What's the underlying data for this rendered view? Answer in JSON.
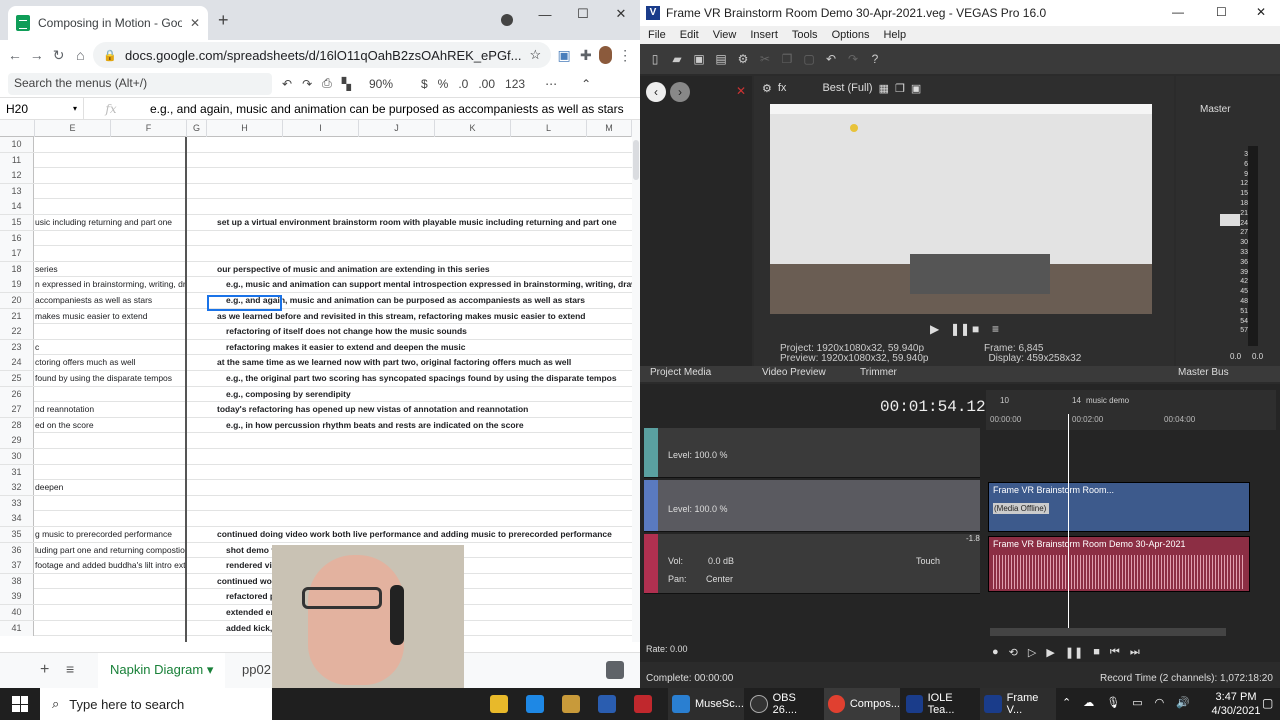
{
  "chrome": {
    "tab_title": "Composing in Motion - Google S",
    "url": "docs.google.com/spreadsheets/d/16lO11qOahB2zsOAhREK_ePGf...",
    "menu_search_placeholder": "Search the menus (Alt+/)",
    "zoom": "90%",
    "currency": "$",
    "percent": "%",
    "dec_less": ".0",
    "dec_more": ".00",
    "format_more": "123"
  },
  "formula": {
    "cell_ref": "H20",
    "fx": "fx",
    "content": "e.g., and again, music and animation can be purposed as accompaniests as well as stars"
  },
  "columns": [
    "E",
    "F",
    "G",
    "H",
    "I",
    "J",
    "K",
    "L",
    "M"
  ],
  "rows": [
    {
      "n": "10",
      "e": "",
      "h": "",
      "ind": false
    },
    {
      "n": "11",
      "e": "",
      "h": "",
      "ind": false
    },
    {
      "n": "12",
      "e": "",
      "h": "",
      "ind": false
    },
    {
      "n": "13",
      "e": "",
      "h": "",
      "ind": false
    },
    {
      "n": "14",
      "e": "",
      "h": "",
      "ind": false
    },
    {
      "n": "15",
      "e": "usic including returning and part one",
      "h": "set up a virtual environment brainstorm room with playable music including returning and part one",
      "ind": false
    },
    {
      "n": "16",
      "e": "",
      "h": "",
      "ind": false
    },
    {
      "n": "17",
      "e": "",
      "h": "",
      "ind": false
    },
    {
      "n": "18",
      "e": "series",
      "h": "our perspective of music and animation are extending in this series",
      "ind": false
    },
    {
      "n": "19",
      "e": "n expressed in brainstorming, writing, drawing",
      "h": "e.g., music and animation can support mental introspection expressed in brainstorming, writing, drawing",
      "ind": true
    },
    {
      "n": "20",
      "e": "accompaniests as well as stars",
      "h": "e.g., and again, music and animation can be purposed as accompaniests as well as stars",
      "ind": true
    },
    {
      "n": "21",
      "e": "makes music easier to extend",
      "h": "as we learned before and revisited in this stream, refactoring makes music easier to extend",
      "ind": false
    },
    {
      "n": "22",
      "e": "",
      "h": "refactoring of itself does not change how the music sounds",
      "ind": true
    },
    {
      "n": "23",
      "e": "c",
      "h": "refactoring makes it easier to extend and deepen the music",
      "ind": true
    },
    {
      "n": "24",
      "e": "ctoring offers much as well",
      "h": "at the same time as we learned now with part two, original factoring offers much as well",
      "ind": false
    },
    {
      "n": "25",
      "e": "found by using the disparate tempos",
      "h": "e.g., the original part two scoring has syncopated spacings found by using the disparate tempos",
      "ind": true
    },
    {
      "n": "26",
      "e": "",
      "h": "e.g., composing by serendipity",
      "ind": true
    },
    {
      "n": "27",
      "e": "nd reannotation",
      "h": "today's refactoring has opened up new vistas of annotation and reannotation",
      "ind": false
    },
    {
      "n": "28",
      "e": "ed on the score",
      "h": "e.g., in how percussion rhythm beats and rests are indicated on the score",
      "ind": true
    },
    {
      "n": "29",
      "e": "",
      "h": "",
      "ind": false
    },
    {
      "n": "30",
      "e": "",
      "h": "",
      "ind": false
    },
    {
      "n": "31",
      "e": "",
      "h": "",
      "ind": false
    },
    {
      "n": "32",
      "e": "deepen",
      "h": "",
      "ind": false
    },
    {
      "n": "33",
      "e": "",
      "h": "",
      "ind": false
    },
    {
      "n": "34",
      "e": "",
      "h": "",
      "ind": false
    },
    {
      "n": "35",
      "e": "g music to prerecorded performance",
      "h": "continued doing video work both live performance and adding music to prerecorded performance",
      "ind": false
    },
    {
      "n": "36",
      "e": "luding part one and returning compostions",
      "h": "shot demo v                                            ing part one and returning compostions",
      "ind": true
    },
    {
      "n": "37",
      "e": "footage and added buddha's lilt intro extro",
      "h": "rendered vi                                            otage and added buddha's lilt intro extro",
      "ind": true
    },
    {
      "n": "38",
      "e": "",
      "h": "continued wor",
      "ind": false
    },
    {
      "n": "39",
      "e": "",
      "h": "refactored p",
      "ind": true
    },
    {
      "n": "40",
      "e": "",
      "h": "extended en",
      "ind": true
    },
    {
      "n": "41",
      "e": "",
      "h": "added kick,",
      "ind": true
    }
  ],
  "sheet_tabs": {
    "active": "Napkin Diagram",
    "other": "pp02"
  },
  "vegas": {
    "title": "Frame VR Brainstorm Room Demo 30-Apr-2021.veg - VEGAS Pro 16.0",
    "menu": [
      "File",
      "Edit",
      "View",
      "Insert",
      "Tools",
      "Options",
      "Help"
    ],
    "preview_quality": "Best (Full)",
    "project": "Project:  1920x1080x32, 59.940p",
    "preview": "Preview:  1920x1080x32, 59.940p",
    "frame": "Frame:     6,845",
    "display": "Display:   459x258x32",
    "master": "Master",
    "tabs": [
      "Project Media",
      "Video Preview",
      "Trimmer",
      "Master Bus"
    ],
    "timecode": "00:01:54.12",
    "markers": [
      "10",
      "14",
      "music demo"
    ],
    "ruler": [
      "00:00:00",
      "00:02:00",
      "00:04:00"
    ],
    "track1_level": "Level: 100.0 %",
    "track2_level": "Level: 100.0 %",
    "audio_vol_label": "Vol:",
    "audio_vol": "0.0 dB",
    "audio_pan_label": "Pan:",
    "audio_pan": "Center",
    "touch": "Touch",
    "clip_video": "Frame VR Brainstorm Room...",
    "clip_audio": "Frame VR Brainstorm Room Demo 30-Apr-2021",
    "offline": "(Media Offline)",
    "rate": "Rate: 0.00",
    "complete": "Complete: 00:00:00",
    "record_time": "Record Time (2 channels): 1,072:18:20",
    "meter_scale": [
      "3",
      "6",
      "9",
      "12",
      "15",
      "18",
      "21",
      "24",
      "27",
      "30",
      "33",
      "36",
      "39",
      "42",
      "45",
      "48",
      "51",
      "54",
      "57"
    ],
    "meter_zero": [
      "0.0",
      "0.0"
    ],
    "peak": "-1.8"
  },
  "taskbar": {
    "search_placeholder": "Type here to search",
    "apps": [
      "MuseSc...",
      "OBS 26....",
      "Compos...",
      "IOLE Tea...",
      "Frame V..."
    ],
    "time": "3:47 PM",
    "date": "4/30/2021"
  }
}
